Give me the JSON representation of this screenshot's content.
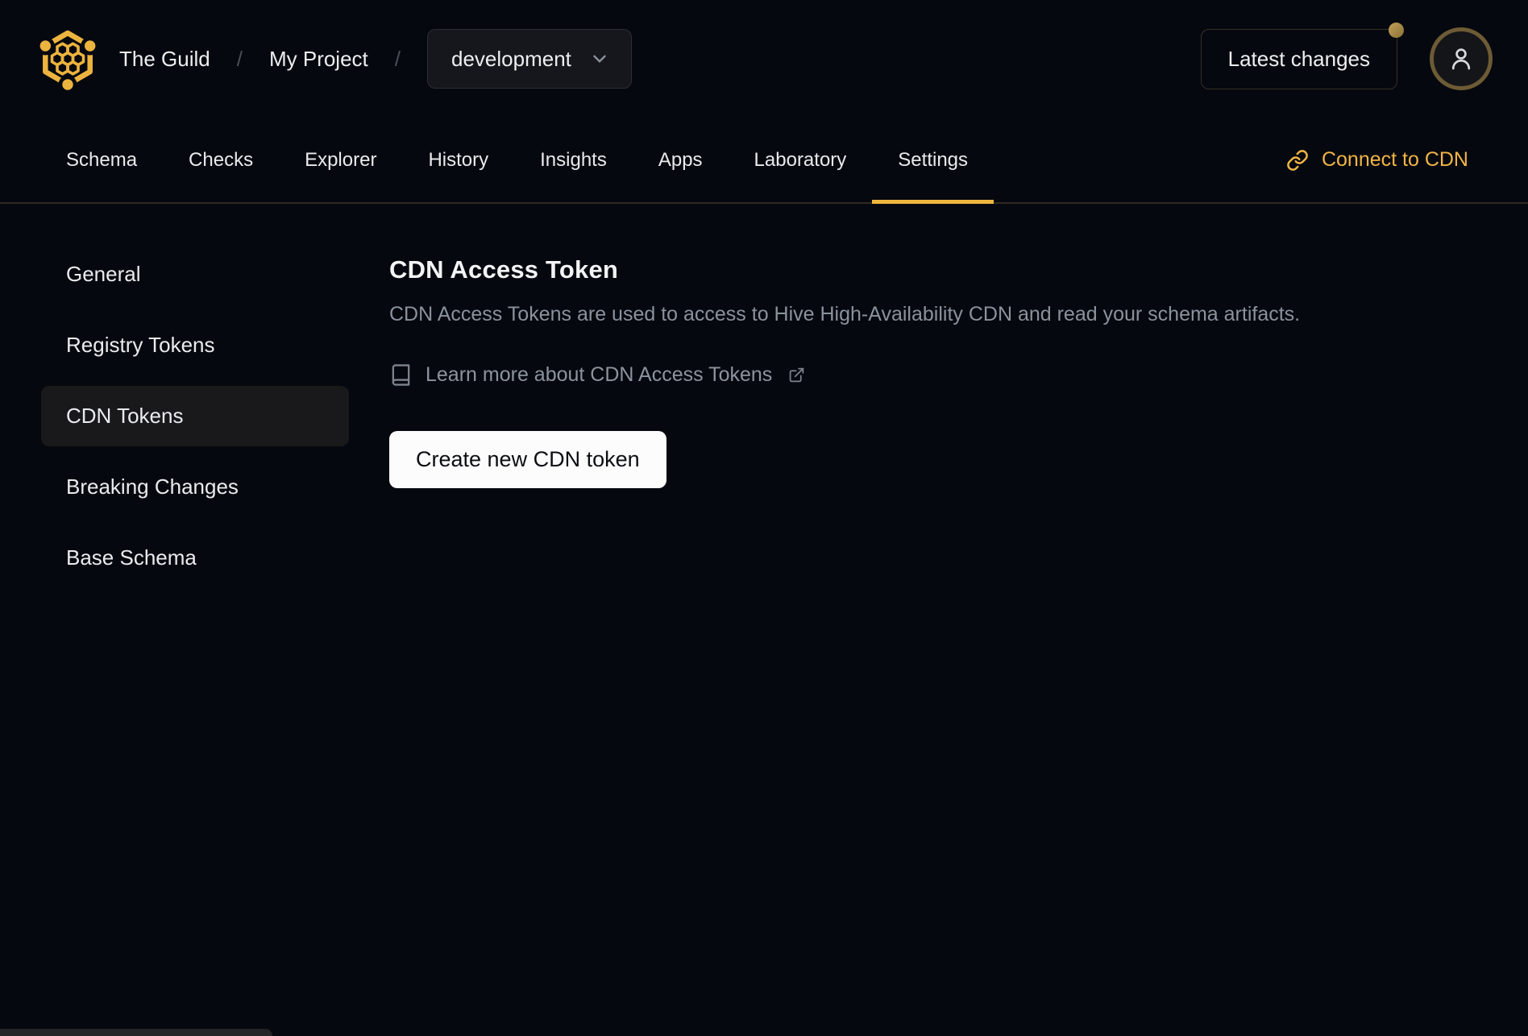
{
  "header": {
    "breadcrumb": {
      "org": "The Guild",
      "project": "My Project",
      "separator": "/"
    },
    "target_selector": {
      "value": "development"
    },
    "latest_changes_label": "Latest changes",
    "icons": {
      "logo": "hive-honeycomb-logo",
      "target_chevron": "chevron-down-icon",
      "notification": "notification-dot",
      "avatar": "user-icon"
    }
  },
  "nav_tabs": {
    "items": [
      {
        "label": "Schema",
        "active": false
      },
      {
        "label": "Checks",
        "active": false
      },
      {
        "label": "Explorer",
        "active": false
      },
      {
        "label": "History",
        "active": false
      },
      {
        "label": "Insights",
        "active": false
      },
      {
        "label": "Apps",
        "active": false
      },
      {
        "label": "Laboratory",
        "active": false
      },
      {
        "label": "Settings",
        "active": true
      }
    ],
    "connect_cdn": {
      "label": "Connect to CDN",
      "icon": "link-chain-icon"
    }
  },
  "sidebar": {
    "items": [
      {
        "label": "General",
        "active": false
      },
      {
        "label": "Registry Tokens",
        "active": false
      },
      {
        "label": "CDN Tokens",
        "active": true
      },
      {
        "label": "Breaking Changes",
        "active": false
      },
      {
        "label": "Base Schema",
        "active": false
      }
    ]
  },
  "main": {
    "title": "CDN Access Token",
    "description": "CDN Access Tokens are used to access to Hive High-Availability CDN and read your schema artifacts.",
    "learn_more": {
      "label": "Learn more about CDN Access Tokens",
      "left_icon": "book-icon",
      "right_icon": "external-link-icon"
    },
    "create_button_label": "Create new CDN token"
  },
  "colors": {
    "background": "#05080e",
    "accent_gold": "#f1b546",
    "tab_underline": "#eeb63f",
    "muted_text": "#8b929c",
    "active_item_background": "#19191b",
    "create_button_background": "#fcfcfc",
    "avatar_ring": "#6d5b35",
    "notification_dot": "#a98b49"
  }
}
